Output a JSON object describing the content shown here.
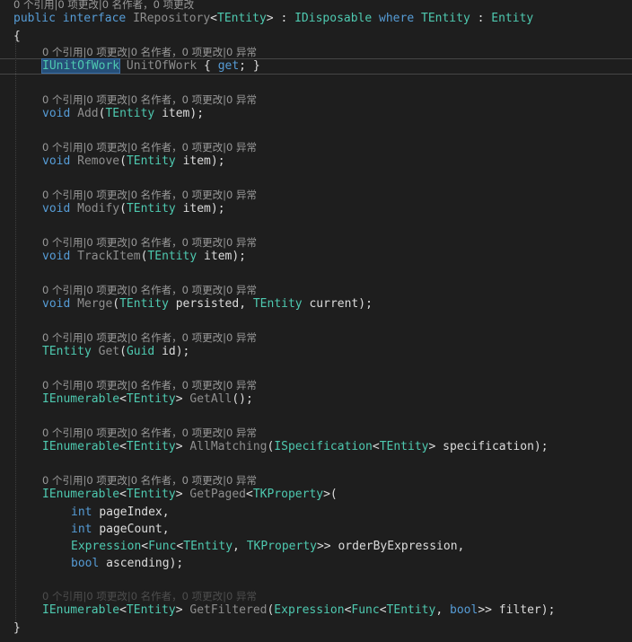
{
  "lens_top": "0 个引用|0 项更改|0 名作者，0 项更改",
  "lens_member": "0 个引用|0 项更改|0 名作者，0 项更改|0 异常",
  "kw": {
    "public": "public",
    "interface": "interface",
    "where": "where",
    "void": "void",
    "get": "get",
    "int": "int",
    "bool": "bool"
  },
  "types": {
    "IRepository": "IRepository",
    "TEntity": "TEntity",
    "IDisposable": "IDisposable",
    "Entity": "Entity",
    "IUnitOfWork": "IUnitOfWork",
    "Guid": "Guid",
    "IEnumerable": "IEnumerable",
    "ISpecification": "ISpecification",
    "TKProperty": "TKProperty",
    "Expression": "Expression",
    "Func": "Func"
  },
  "methods": {
    "UnitOfWork": "UnitOfWork",
    "Add": "Add",
    "Remove": "Remove",
    "Modify": "Modify",
    "TrackItem": "TrackItem",
    "Merge": "Merge",
    "Get": "Get",
    "GetAll": "GetAll",
    "AllMatching": "AllMatching",
    "GetPaged": "GetPaged",
    "GetFiltered": "GetFiltered"
  },
  "params": {
    "item": "item",
    "persisted": "persisted",
    "current": "current",
    "id": "id",
    "specification": "specification",
    "pageIndex": "pageIndex",
    "pageCount": "pageCount",
    "orderByExpression": "orderByExpression",
    "ascending": "ascending",
    "filter": "filter"
  },
  "colors": {
    "background": "#1e1e1e",
    "keyword": "#569cd6",
    "type": "#4ec9b0",
    "method": "#8e8e8e",
    "text": "#dcdcdc",
    "codelens": "#9a9a9a",
    "selection": "#264f78"
  }
}
